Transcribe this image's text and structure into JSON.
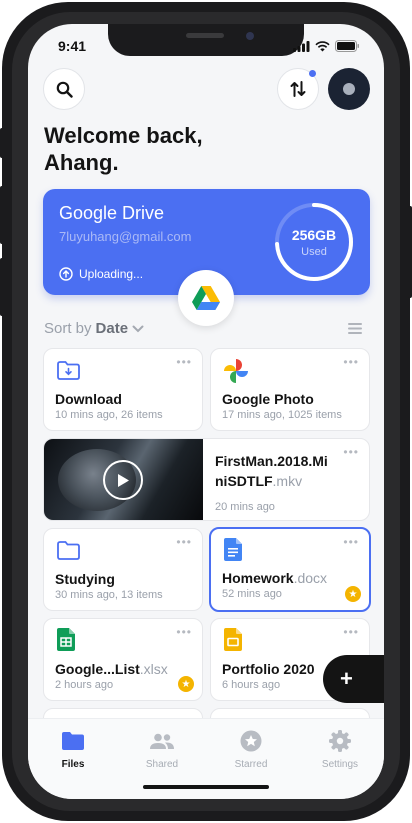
{
  "status": {
    "time": "9:41"
  },
  "header": {
    "greeting": "Welcome back,\nAhang."
  },
  "drive": {
    "title": "Google Drive",
    "email": "7luyuhang@gmail.com",
    "upload_label": "Uploading...",
    "usage_value": "256GB",
    "usage_label": "Used",
    "usage_fraction": 0.74
  },
  "sort": {
    "prefix": "Sort by",
    "value": "Date"
  },
  "files": [
    {
      "name": "Download",
      "ext": "",
      "meta": "10 mins ago, 26 items",
      "icon": "folder-download-icon"
    },
    {
      "name": "Google Photo",
      "ext": "",
      "meta": "17 mins ago, 1025 items",
      "icon": "google-photos-icon"
    },
    {
      "name_line1": "FirstMan.2018.Mi",
      "name_line2": "niSDTLF",
      "ext": ".mkv",
      "meta": "20 mins ago",
      "icon": "video-thumbnail"
    },
    {
      "name": "Studying",
      "ext": "",
      "meta": "30 mins ago, 13 items",
      "icon": "folder-icon"
    },
    {
      "name": "Homework",
      "ext": ".docx",
      "meta": "52 mins ago",
      "icon": "docs-icon",
      "starred": true,
      "selected": true
    },
    {
      "name": "Google...List",
      "ext": ".xlsx",
      "meta": "2 hours ago",
      "icon": "sheets-icon",
      "starred": true
    },
    {
      "name": "Portfolio 2020",
      "ext": "",
      "meta": "6 hours ago",
      "icon": "slides-icon"
    }
  ],
  "fab": {
    "label": "+"
  },
  "tabs": [
    {
      "label": "Files",
      "icon": "folder-icon",
      "active": true
    },
    {
      "label": "Shared",
      "icon": "people-icon"
    },
    {
      "label": "Starred",
      "icon": "star-icon"
    },
    {
      "label": "Settings",
      "icon": "gear-icon"
    }
  ],
  "colors": {
    "accent": "#4b6ff2",
    "star": "#f4b400",
    "dark": "#141414"
  }
}
